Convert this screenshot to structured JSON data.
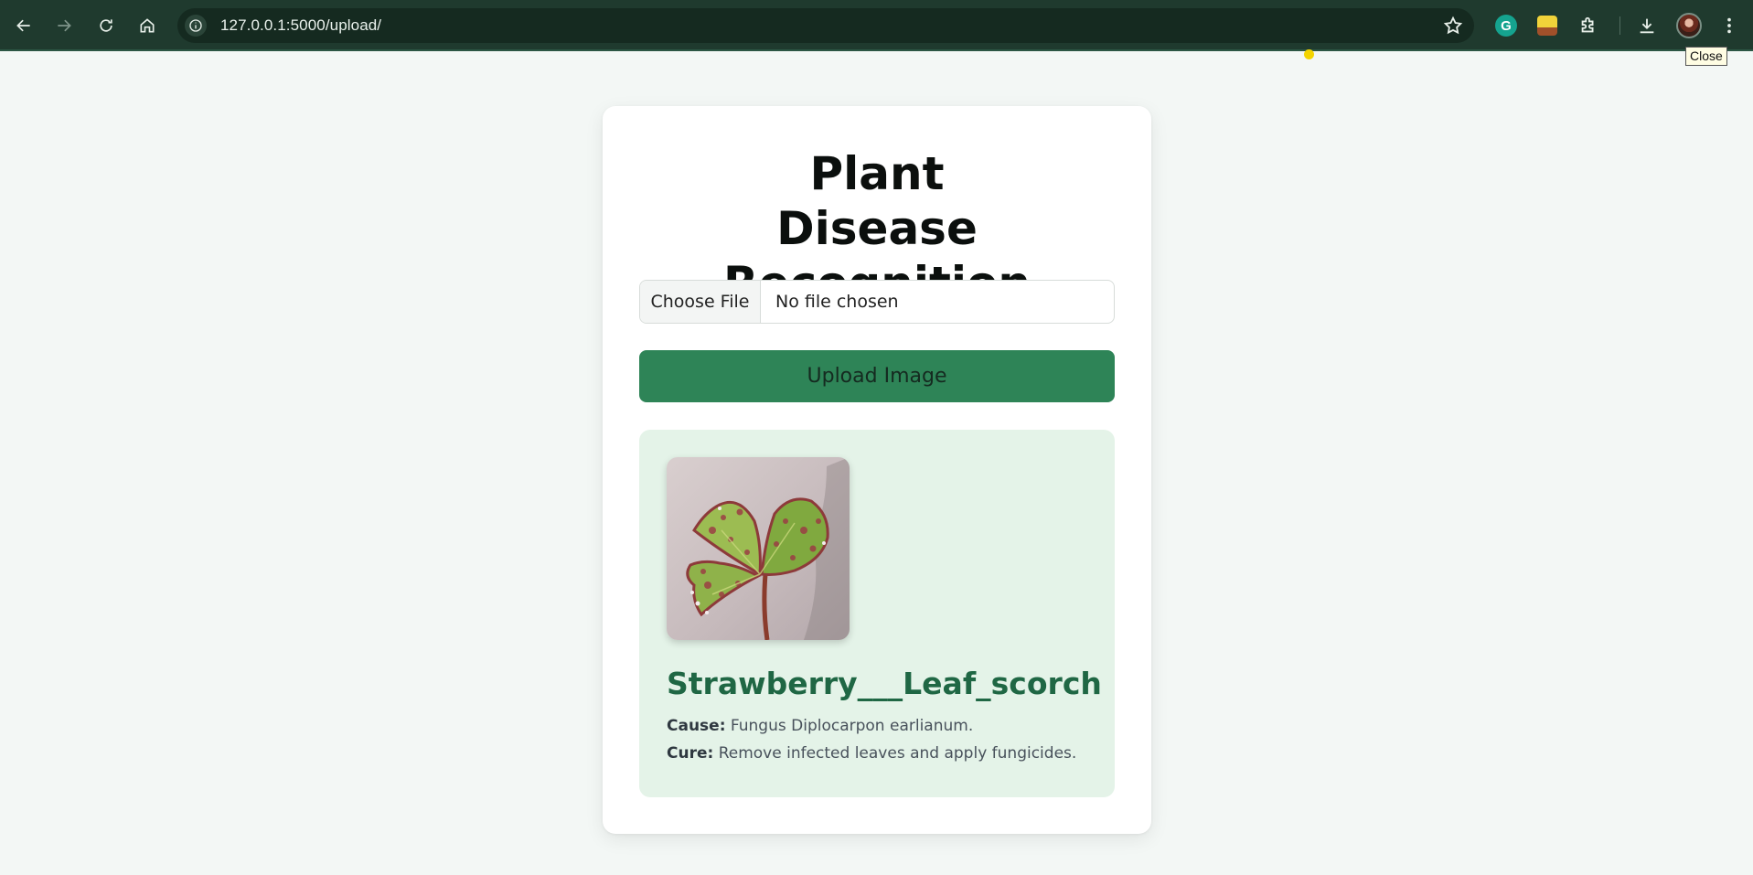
{
  "browser": {
    "url": "127.0.0.1:5000/upload/",
    "tooltip": "Close",
    "icons": {
      "back": "arrow-left-icon",
      "forward": "arrow-right-icon",
      "reload": "reload-icon",
      "home": "home-icon",
      "site_info": "info-icon",
      "bookmark": "star-icon",
      "grammarly": "grammarly-icon",
      "extension_app": "extension-app-icon",
      "extensions": "puzzle-icon",
      "downloads": "download-icon",
      "profile": "avatar",
      "menu": "kebab-menu-icon"
    },
    "grammarly_letter": "G"
  },
  "page": {
    "title": "Plant Disease Recognition",
    "file_input": {
      "button_label": "Choose File",
      "status": "No file chosen"
    },
    "upload_button": "Upload Image",
    "result": {
      "disease_name": "Strawberry___Leaf_scorch",
      "cause_label": "Cause:",
      "cause_text": "Fungus Diplocarpon earlianum.",
      "cure_label": "Cure:",
      "cure_text": "Remove infected leaves and apply fungicides."
    }
  },
  "colors": {
    "toolbar": "#1f3a2e",
    "page_bg": "#f3f7f5",
    "upload_button": "#2e8457",
    "result_bg": "#e4f3e8",
    "disease_text": "#1f6744"
  }
}
